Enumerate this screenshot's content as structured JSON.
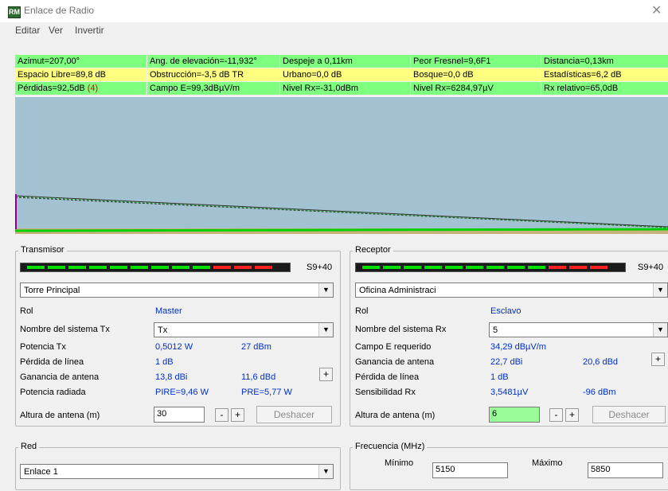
{
  "window": {
    "title": "Enlace de Radio",
    "close_glyph": "✕",
    "icon_text": "RM"
  },
  "menu": [
    "Editar",
    "Ver",
    "Invertir"
  ],
  "stats": {
    "r1": [
      "Azimut=207,00°",
      "Ang. de elevación=-11,932°",
      "Despeje a 0,11km",
      "Peor Fresnel=9,6F1",
      "Distancia=0,13km"
    ],
    "r2": [
      "Espacio Libre=89,8 dB",
      "Obstrucción=-3,5 dB TR",
      "Urbano=0,0 dB",
      "Bosque=0,0 dB",
      "Estadísticas=6,2 dB"
    ],
    "r3": [
      "Pérdidas=92,5dB",
      "(4)",
      "Campo E=99,3dBµV/m",
      "Nivel Rx=-31,0dBm",
      "Nivel Rx=6284,97µV",
      "Rx relativo=65,0dB"
    ]
  },
  "colors": {
    "green": "#7fff7f",
    "yellow": "#ffff80",
    "profile_bg": "#a3c2d1",
    "value_blue": "#0030d0"
  },
  "transmitter": {
    "label": "Transmisor",
    "signal": "S9+40",
    "station": "Torre Principal",
    "role_label": "Rol",
    "role": "Master",
    "sys_label": "Nombre del sistema Tx",
    "sys": "Tx",
    "power_label": "Potencia Tx",
    "power_w": "0,5012 W",
    "power_dbm": "27 dBm",
    "loss_label": "Pérdida de línea",
    "loss": "1 dB",
    "gain_label": "Ganancia de antena",
    "gain_dbi": "13,8 dBi",
    "gain_dbd": "11,6 dBd",
    "radiated_label": "Potencia radiada",
    "pire": "PIRE=9,46 W",
    "pre": "PRE=5,77 W",
    "height_label": "Altura de antena (m)",
    "height": "30",
    "plus": "+",
    "minus": "-",
    "undo": "Deshacer"
  },
  "receiver": {
    "label": "Receptor",
    "signal": "S9+40",
    "station": "Oficina Administraci",
    "role_label": "Rol",
    "role": "Esclavo",
    "sys_label": "Nombre del sistema Rx",
    "sys": "5",
    "field_label": "Campo E requerido",
    "field": "34,29 dBµV/m",
    "gain_label": "Ganancia de antena",
    "gain_dbi": "22,7 dBi",
    "gain_dbd": "20,6 dBd",
    "loss_label": "Pérdida de línea",
    "loss": "1 dB",
    "sens_label": "Sensibilidad Rx",
    "sens_uv": "3,5481µV",
    "sens_dbm": "-96 dBm",
    "height_label": "Altura de antena (m)",
    "height": "6",
    "plus": "+",
    "minus": "-",
    "undo": "Deshacer"
  },
  "network": {
    "label": "Red",
    "name": "Enlace 1"
  },
  "frequency": {
    "label": "Frecuencia (MHz)",
    "min_label": "Mínimo",
    "min": "5150",
    "max_label": "Máximo",
    "max": "5850"
  }
}
